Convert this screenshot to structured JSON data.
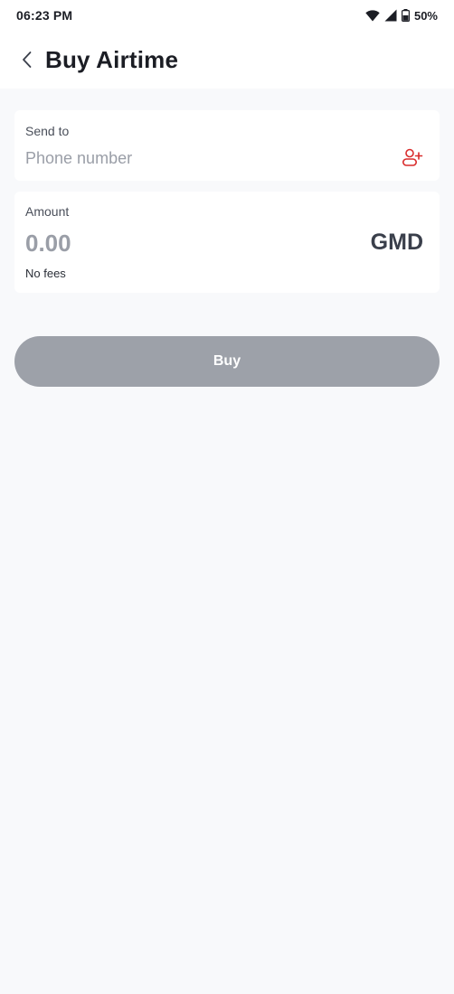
{
  "status_bar": {
    "time": "06:23 PM",
    "battery": "50%",
    "icons": [
      "wifi-icon",
      "signal-icon",
      "battery-icon"
    ]
  },
  "header": {
    "title": "Buy Airtime",
    "back_icon": "chevron-left-icon"
  },
  "send_to": {
    "label": "Send to",
    "placeholder": "Phone number",
    "value": "",
    "contact_icon": "add-contact-icon"
  },
  "amount": {
    "label": "Amount",
    "placeholder": "0.00",
    "value": "",
    "currency": "GMD",
    "fees_note": "No fees"
  },
  "actions": {
    "buy_label": "Buy"
  },
  "colors": {
    "accent": "#d92b2b",
    "button_disabled": "#9da1a9",
    "background": "#f8f9fb",
    "card": "#ffffff"
  }
}
